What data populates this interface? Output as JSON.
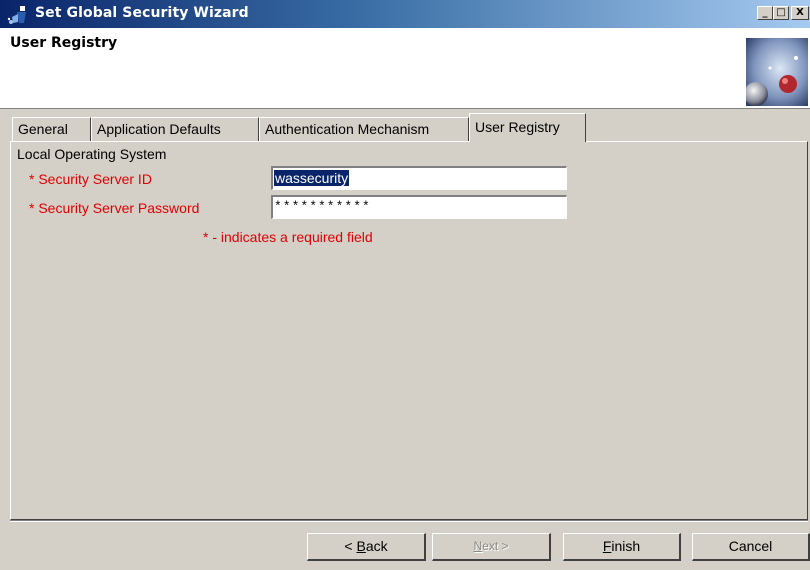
{
  "window": {
    "title": "Set Global Security Wizard",
    "minimize_glyph": "_",
    "maximize_glyph": "□",
    "close_glyph": "X"
  },
  "header": {
    "title": "User Registry",
    "logo_icon": "globe-logo-icon"
  },
  "tabs": [
    {
      "label": "General",
      "active": false
    },
    {
      "label": "Application Defaults",
      "active": false
    },
    {
      "label": "Authentication Mechanism",
      "active": false
    },
    {
      "label": "User Registry",
      "active": true
    }
  ],
  "panel": {
    "section_label": "Local Operating System",
    "server_id": {
      "label": "* Security Server ID",
      "value": "wassecurity"
    },
    "server_password": {
      "label": "* Security Server Password",
      "value": "***********"
    },
    "required_note": "* - indicates a required field"
  },
  "buttons": {
    "back": {
      "prefix": "< ",
      "mnemonic": "B",
      "rest": "ack",
      "enabled": true
    },
    "next": {
      "mnemonic": "N",
      "rest": "ext >",
      "enabled": false
    },
    "finish": {
      "mnemonic": "F",
      "rest": "inish",
      "enabled": true
    },
    "cancel": {
      "label": "Cancel",
      "enabled": true
    }
  },
  "colors": {
    "title_bar_start": "#0a246a",
    "title_bar_end": "#a6caf0",
    "required_red": "#e00000",
    "selection": "#0a246a",
    "dialog_face": "#d4d0c8"
  }
}
